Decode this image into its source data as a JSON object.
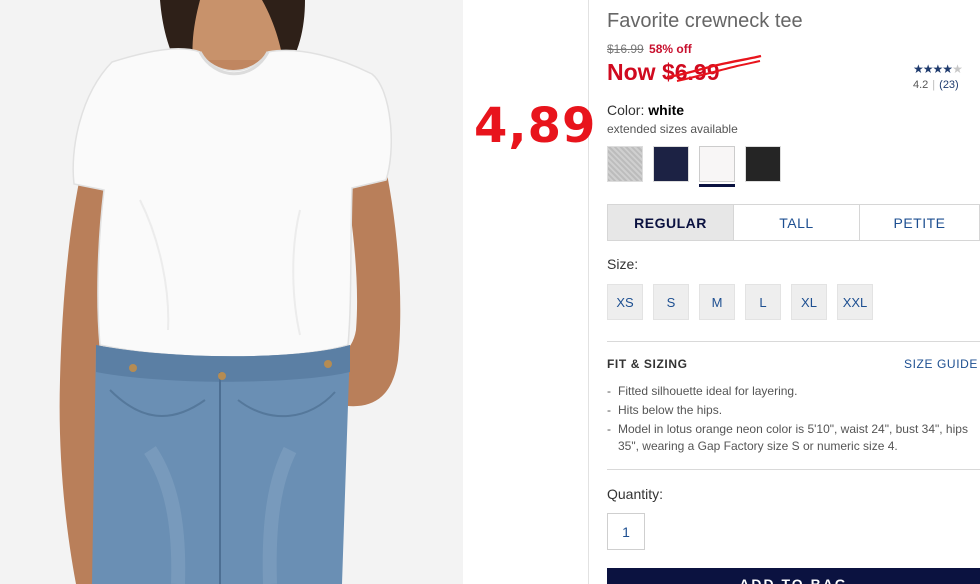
{
  "product": {
    "title": "Favorite crewneck tee",
    "original_price": "$16.99",
    "discount": "58% off",
    "now_prefix": "Now",
    "now_price": "$6.99",
    "annotated_price": "4,89"
  },
  "rating": {
    "stars": 4,
    "max_stars": 5,
    "value": "4.2",
    "count": "(23)"
  },
  "color": {
    "label": "Color:",
    "selected": "white",
    "note": "extended sizes available",
    "swatches": [
      {
        "name": "heather grey",
        "color": "#c6c6c6"
      },
      {
        "name": "navy",
        "color": "#1c2244"
      },
      {
        "name": "white",
        "color": "#f8f6f6",
        "selected": true
      },
      {
        "name": "black",
        "color": "#252525"
      }
    ]
  },
  "fit_tabs": [
    {
      "label": "REGULAR",
      "active": true
    },
    {
      "label": "TALL",
      "active": false
    },
    {
      "label": "PETITE",
      "active": false
    }
  ],
  "size": {
    "label": "Size:",
    "options": [
      "XS",
      "S",
      "M",
      "L",
      "XL",
      "XXL"
    ]
  },
  "fit_sizing": {
    "heading": "FIT & SIZING",
    "guide_link": "SIZE GUIDE",
    "bullets": [
      "Fitted silhouette ideal for layering.",
      "Hits below the hips.",
      "Model in lotus orange neon color is 5'10\", waist 24\", bust 34\", hips 35\", wearing a Gap Factory size S or numeric size 4."
    ]
  },
  "quantity": {
    "label": "Quantity:",
    "value": "1"
  },
  "cta": {
    "add_to_bag": "ADD TO BAG"
  },
  "colors": {
    "accent_red": "#d00a1f",
    "navy": "#0b1240",
    "link_blue": "#1d4f91"
  }
}
